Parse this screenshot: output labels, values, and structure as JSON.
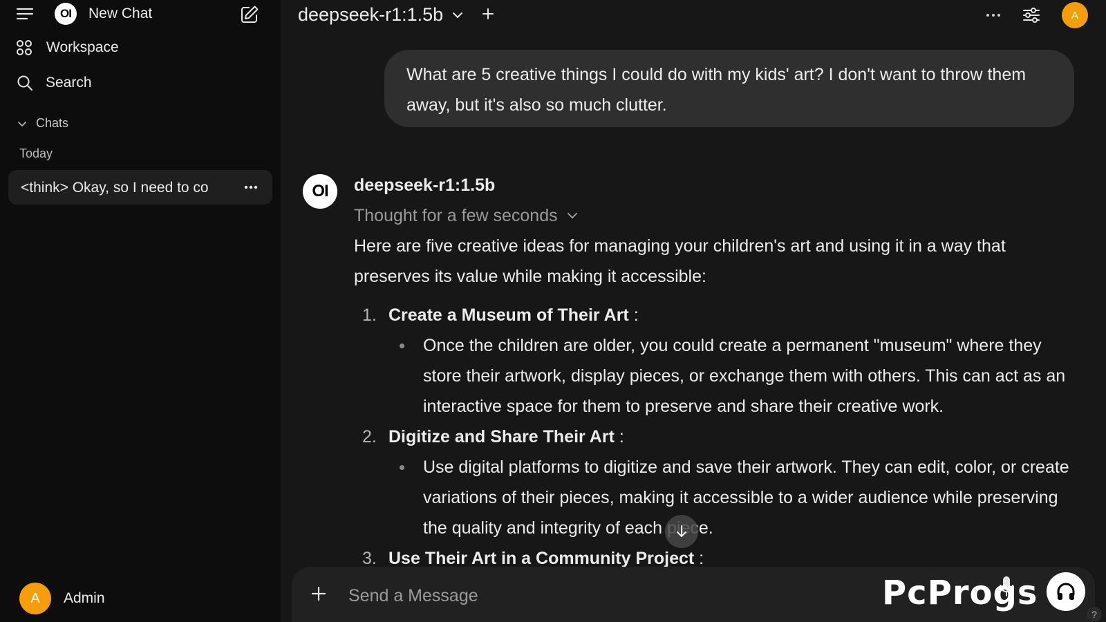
{
  "sidebar": {
    "new_chat_label": "New Chat",
    "logo_text": "OI",
    "workspace_label": "Workspace",
    "search_label": "Search",
    "chats_section_label": "Chats",
    "today_label": "Today",
    "chat_items": [
      {
        "label": "<think> Okay, so I need to co"
      }
    ],
    "user": {
      "initial": "A",
      "name": "Admin"
    }
  },
  "header": {
    "model_name": "deepseek-r1:1.5b",
    "avatar_initial": "A"
  },
  "conversation": {
    "user_message": "What are 5 creative things I could do with my kids' art? I don't want to throw them away, but it's also so much clutter.",
    "assistant": {
      "logo_text": "OI",
      "model_name": "deepseek-r1:1.5b",
      "thought_label": "Thought for a few seconds",
      "intro": "Here are five creative ideas for managing your children's art and using it in a way that preserves its value while making it accessible:",
      "items": [
        {
          "number": "1.",
          "title": "Create a Museum of Their Art",
          "suffix": " :",
          "bullet": "Once the children are older, you could create a permanent \"museum\" where they store their artwork, display pieces, or exchange them with others. This can act as an interactive space for them to preserve and share their creative work."
        },
        {
          "number": "2.",
          "title": "Digitize and Share Their Art",
          "suffix": " :",
          "bullet": "Use digital platforms to digitize and save their artwork. They can edit, color, or create variations of their pieces, making it accessible to a wider audience while preserving the quality and integrity of each piece."
        },
        {
          "number": "3.",
          "title": "Use Their Art in a Community Project",
          "suffix": " :"
        }
      ]
    }
  },
  "composer": {
    "placeholder": "Send a Message"
  },
  "watermark": "PcProgs",
  "help_label": "?",
  "colors": {
    "sidebar_bg": "#0d0d0d",
    "main_bg": "#171717",
    "bubble_bg": "#2f2f2f",
    "avatar": "#f59e0b"
  }
}
